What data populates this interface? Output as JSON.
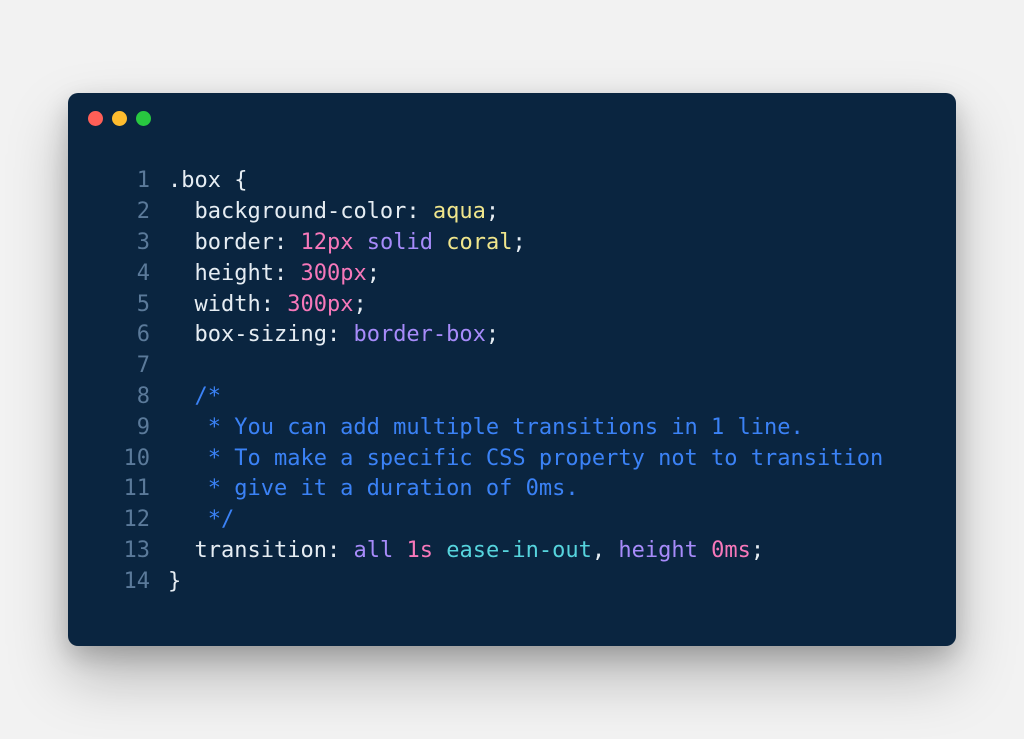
{
  "colors": {
    "bg": "#0a2540",
    "lineNumber": "#5b7a9a",
    "text": "#e6edf3",
    "number": "#f778ba",
    "keyword": "#a78bfa",
    "value": "#f0e68c",
    "comment": "#3b82f6",
    "easing": "#56d4dd"
  },
  "windowControls": [
    "close",
    "minimize",
    "maximize"
  ],
  "code": {
    "language": "css",
    "lines": [
      {
        "n": 1,
        "tokens": [
          {
            "t": ".box",
            "c": "tok-selector"
          },
          {
            "t": " {",
            "c": "tok-punct"
          }
        ]
      },
      {
        "n": 2,
        "tokens": [
          {
            "t": "  ",
            "c": ""
          },
          {
            "t": "background-color",
            "c": "tok-prop"
          },
          {
            "t": ": ",
            "c": "tok-punct"
          },
          {
            "t": "aqua",
            "c": "tok-val"
          },
          {
            "t": ";",
            "c": "tok-punct"
          }
        ]
      },
      {
        "n": 3,
        "tokens": [
          {
            "t": "  ",
            "c": ""
          },
          {
            "t": "border",
            "c": "tok-prop"
          },
          {
            "t": ": ",
            "c": "tok-punct"
          },
          {
            "t": "12",
            "c": "tok-num"
          },
          {
            "t": "px",
            "c": "tok-unit"
          },
          {
            "t": " ",
            "c": ""
          },
          {
            "t": "solid",
            "c": "tok-kw"
          },
          {
            "t": " ",
            "c": ""
          },
          {
            "t": "coral",
            "c": "tok-val"
          },
          {
            "t": ";",
            "c": "tok-punct"
          }
        ]
      },
      {
        "n": 4,
        "tokens": [
          {
            "t": "  ",
            "c": ""
          },
          {
            "t": "height",
            "c": "tok-prop"
          },
          {
            "t": ": ",
            "c": "tok-punct"
          },
          {
            "t": "300",
            "c": "tok-num"
          },
          {
            "t": "px",
            "c": "tok-unit"
          },
          {
            "t": ";",
            "c": "tok-punct"
          }
        ]
      },
      {
        "n": 5,
        "tokens": [
          {
            "t": "  ",
            "c": ""
          },
          {
            "t": "width",
            "c": "tok-prop"
          },
          {
            "t": ": ",
            "c": "tok-punct"
          },
          {
            "t": "300",
            "c": "tok-num"
          },
          {
            "t": "px",
            "c": "tok-unit"
          },
          {
            "t": ";",
            "c": "tok-punct"
          }
        ]
      },
      {
        "n": 6,
        "tokens": [
          {
            "t": "  ",
            "c": ""
          },
          {
            "t": "box-sizing",
            "c": "tok-prop"
          },
          {
            "t": ": ",
            "c": "tok-punct"
          },
          {
            "t": "border-box",
            "c": "tok-kw"
          },
          {
            "t": ";",
            "c": "tok-punct"
          }
        ]
      },
      {
        "n": 7,
        "tokens": [
          {
            "t": "",
            "c": ""
          }
        ]
      },
      {
        "n": 8,
        "tokens": [
          {
            "t": "  ",
            "c": ""
          },
          {
            "t": "/*",
            "c": "tok-comment"
          }
        ]
      },
      {
        "n": 9,
        "tokens": [
          {
            "t": "   * You can add multiple transitions in 1 line.",
            "c": "tok-comment"
          }
        ]
      },
      {
        "n": 10,
        "tokens": [
          {
            "t": "   * To make a specific CSS property not to transition",
            "c": "tok-comment"
          }
        ]
      },
      {
        "n": 11,
        "tokens": [
          {
            "t": "   * give it a duration of 0ms.",
            "c": "tok-comment"
          }
        ]
      },
      {
        "n": 12,
        "tokens": [
          {
            "t": "   */",
            "c": "tok-comment"
          }
        ]
      },
      {
        "n": 13,
        "tokens": [
          {
            "t": "  ",
            "c": ""
          },
          {
            "t": "transition",
            "c": "tok-prop"
          },
          {
            "t": ": ",
            "c": "tok-punct"
          },
          {
            "t": "all",
            "c": "tok-kw"
          },
          {
            "t": " ",
            "c": ""
          },
          {
            "t": "1",
            "c": "tok-num"
          },
          {
            "t": "s",
            "c": "tok-unit"
          },
          {
            "t": " ",
            "c": ""
          },
          {
            "t": "ease-in-out",
            "c": "tok-easing"
          },
          {
            "t": ", ",
            "c": "tok-punct"
          },
          {
            "t": "height",
            "c": "tok-func"
          },
          {
            "t": " ",
            "c": ""
          },
          {
            "t": "0",
            "c": "tok-num"
          },
          {
            "t": "ms",
            "c": "tok-unit"
          },
          {
            "t": ";",
            "c": "tok-punct"
          }
        ]
      },
      {
        "n": 14,
        "tokens": [
          {
            "t": "}",
            "c": "tok-punct"
          }
        ]
      }
    ]
  }
}
